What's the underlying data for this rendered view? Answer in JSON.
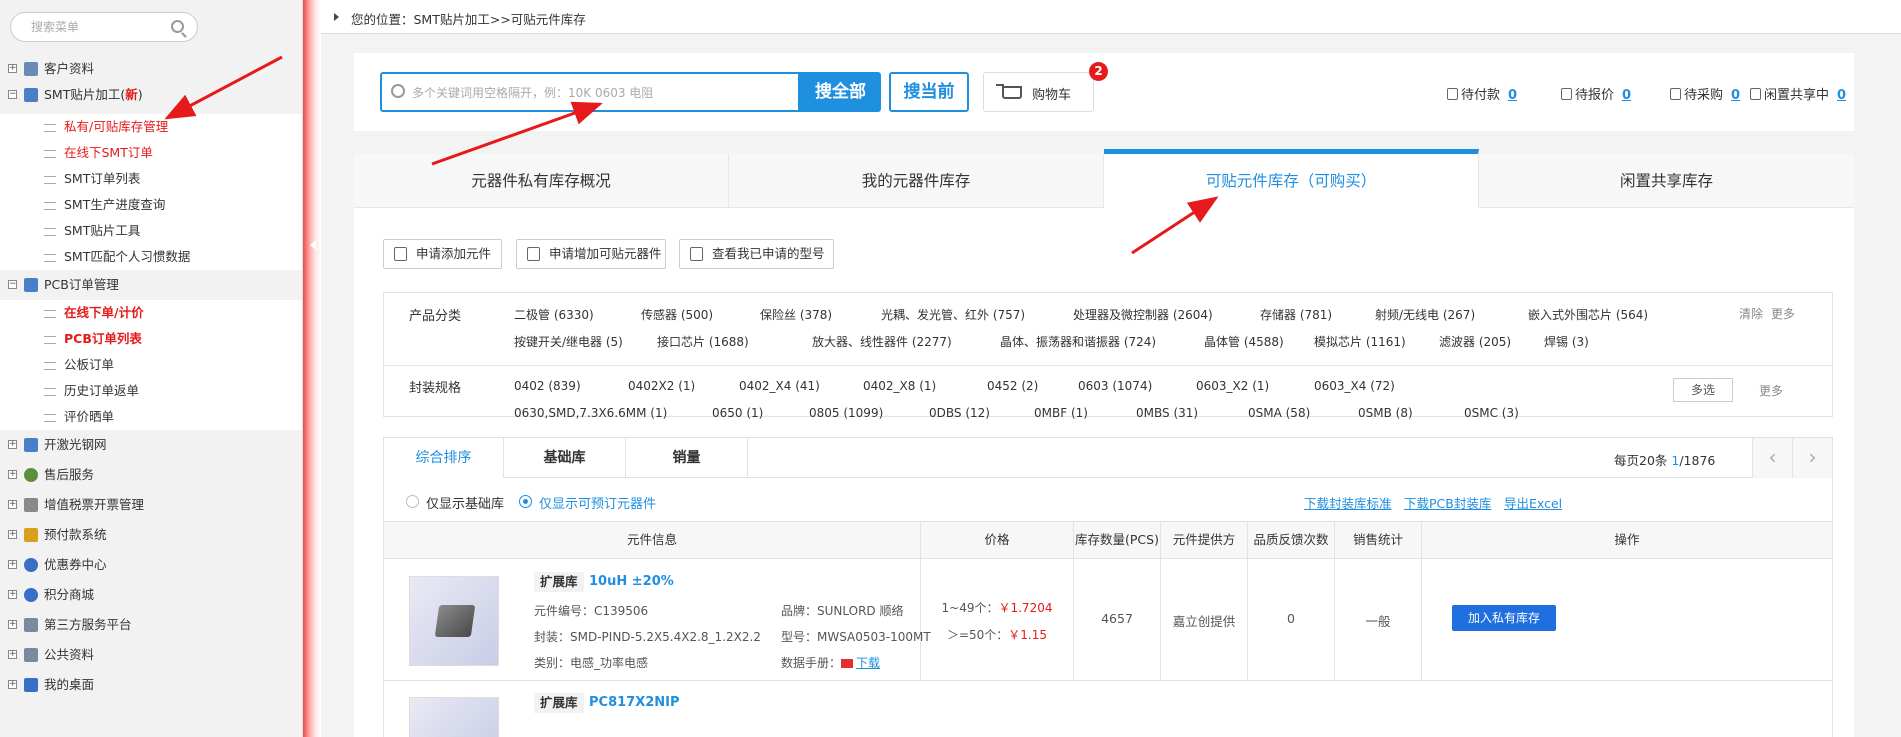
{
  "sidebar": {
    "search_placeholder": "搜索菜单",
    "items": [
      {
        "label": "客户资料"
      },
      {
        "label": "SMT贴片加工(",
        "badge": "新",
        "close": ")"
      },
      {
        "label": "PCB订单管理"
      },
      {
        "label": "开激光钢网"
      },
      {
        "label": "售后服务"
      },
      {
        "label": "增值税票开票管理"
      },
      {
        "label": "预付款系统"
      },
      {
        "label": "优惠券中心"
      },
      {
        "label": "积分商城"
      },
      {
        "label": "第三方服务平台"
      },
      {
        "label": "公共资料"
      },
      {
        "label": "我的桌面"
      }
    ],
    "smt_sub": [
      "私有/可贴库存管理",
      "在线下SMT订单",
      "SMT订单列表",
      "SMT生产进度查询",
      "SMT贴片工具",
      "SMT匹配个人习惯数据"
    ],
    "pcb_sub": [
      "在线下单/计价",
      "PCB订单列表",
      "公板订单",
      "历史订单返单",
      "评价晒单"
    ]
  },
  "breadcrumb": "您的位置：SMT贴片加工>>可贴元件库存",
  "search": {
    "placeholder": "多个关键词用空格隔开，例：10K 0603 电阻",
    "btn_all": "搜全部",
    "btn_current": "搜当前",
    "cart_label": "购物车",
    "cart_count": "2"
  },
  "pending": [
    {
      "label": "待付款",
      "count": "0"
    },
    {
      "label": "待报价",
      "count": "0"
    },
    {
      "label": "待采购",
      "count": "0"
    },
    {
      "label": "闲置共享中",
      "count": "0"
    }
  ],
  "tabs": [
    "元器件私有库存概况",
    "我的元器件库存",
    "可贴元件库存（可购买）",
    "闲置共享库存"
  ],
  "apply_buttons": [
    "申请添加元件",
    "申请增加可贴元器件",
    "查看我已申请的型号"
  ],
  "filter": {
    "category_title": "产品分类",
    "categories_row1": [
      "二极管 (6330)",
      "传感器 (500)",
      "保险丝 (378)",
      "光耦、发光管、红外 (757)",
      "处理器及微控制器 (2604)",
      "存储器 (781)",
      "射频/无线电 (267)",
      "嵌入式外围芯片 (564)"
    ],
    "categories_row2": [
      "按键开关/继电器 (5)",
      "接口芯片 (1688)",
      "放大器、线性器件 (2277)",
      "晶体、振荡器和谐振器 (724)",
      "晶体管 (4588)",
      "模拟芯片 (1161)",
      "滤波器 (205)",
      "焊锡 (3)"
    ],
    "clear": "清除",
    "more": "更多",
    "package_title": "封装规格",
    "packages_row1": [
      "0402 (839)",
      "0402X2 (1)",
      "0402_X4 (41)",
      "0402_X8 (1)",
      "0452 (2)",
      "0603 (1074)",
      "0603_X2 (1)",
      "0603_X4 (72)"
    ],
    "packages_row2": [
      "0630,SMD,7.3X6.6MM (1)",
      "0650 (1)",
      "0805 (1099)",
      "0DBS (12)",
      "0MBF (1)",
      "0MBS (31)",
      "0SMA (58)",
      "0SMB (8)",
      "0SMC (3)"
    ],
    "multi_select": "多选"
  },
  "results": {
    "sort_tabs": [
      "综合排序",
      "基础库",
      "销量"
    ],
    "page_size_label": "每页20条",
    "page_current": "1",
    "page_total": "/1876",
    "radio_basic": "仅显示基础库",
    "radio_orderable": "仅显示可预订元器件",
    "downloads": [
      "下载封装库标准",
      "下载PCB封装库",
      "导出Excel"
    ],
    "headers": [
      "元件信息",
      "价格",
      "库存数量(PCS)",
      "元件提供方",
      "品质反馈次数",
      "销售统计",
      "操作"
    ],
    "row": {
      "tag": "扩展库",
      "name": "10uH ±20%",
      "code": "元件编号：C139506",
      "package": "封装：SMD-PIND-5.2X5.4X2.8_1.2X2.2",
      "category": "类别：电感_功率电感",
      "brand": "品牌：SUNLORD 顺络",
      "model": "型号：MWSA0503-100MT",
      "datasheet_label": "数据手册：",
      "datasheet_link": "下载",
      "price1_label": "1~49个：",
      "price1": "￥1.7204",
      "price2_label": "＞=50个：",
      "price2": "￥1.15",
      "stock": "4657",
      "provider": "嘉立创提供",
      "feedback": "0",
      "sales": "一般",
      "action": "加入私有库存"
    },
    "row2": {
      "tag": "扩展库",
      "name": "PC817X2NIP"
    }
  },
  "colors": {
    "accent": "#1f8fe0",
    "alert": "#e61a1a"
  }
}
